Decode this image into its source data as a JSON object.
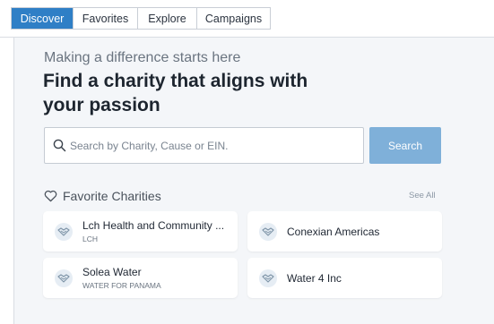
{
  "tabs": [
    {
      "label": "Discover",
      "active": true
    },
    {
      "label": "Favorites",
      "active": false
    },
    {
      "label": "Explore",
      "active": false
    },
    {
      "label": "Campaigns",
      "active": false
    }
  ],
  "hero": {
    "subheading": "Making a difference starts here",
    "headline": "Find a charity that aligns with your passion"
  },
  "search": {
    "placeholder": "Search by Charity, Cause or EIN.",
    "value": "",
    "button_label": "Search",
    "icon": "search-icon"
  },
  "favorites": {
    "title": "Favorite Charities",
    "icon": "heart-icon",
    "see_all_label": "See All",
    "items": [
      {
        "name": "Lch Health and Community ...",
        "subtitle": "LCH"
      },
      {
        "name": "Conexian Americas",
        "subtitle": ""
      },
      {
        "name": "Solea Water",
        "subtitle": "WATER FOR PANAMA"
      },
      {
        "name": "Water 4 Inc",
        "subtitle": ""
      }
    ]
  },
  "colors": {
    "accent": "#2f7fc6",
    "search_button": "#7fb0d9",
    "panel_bg": "#f4f6f9",
    "logo_icon": "#7f95a8"
  }
}
